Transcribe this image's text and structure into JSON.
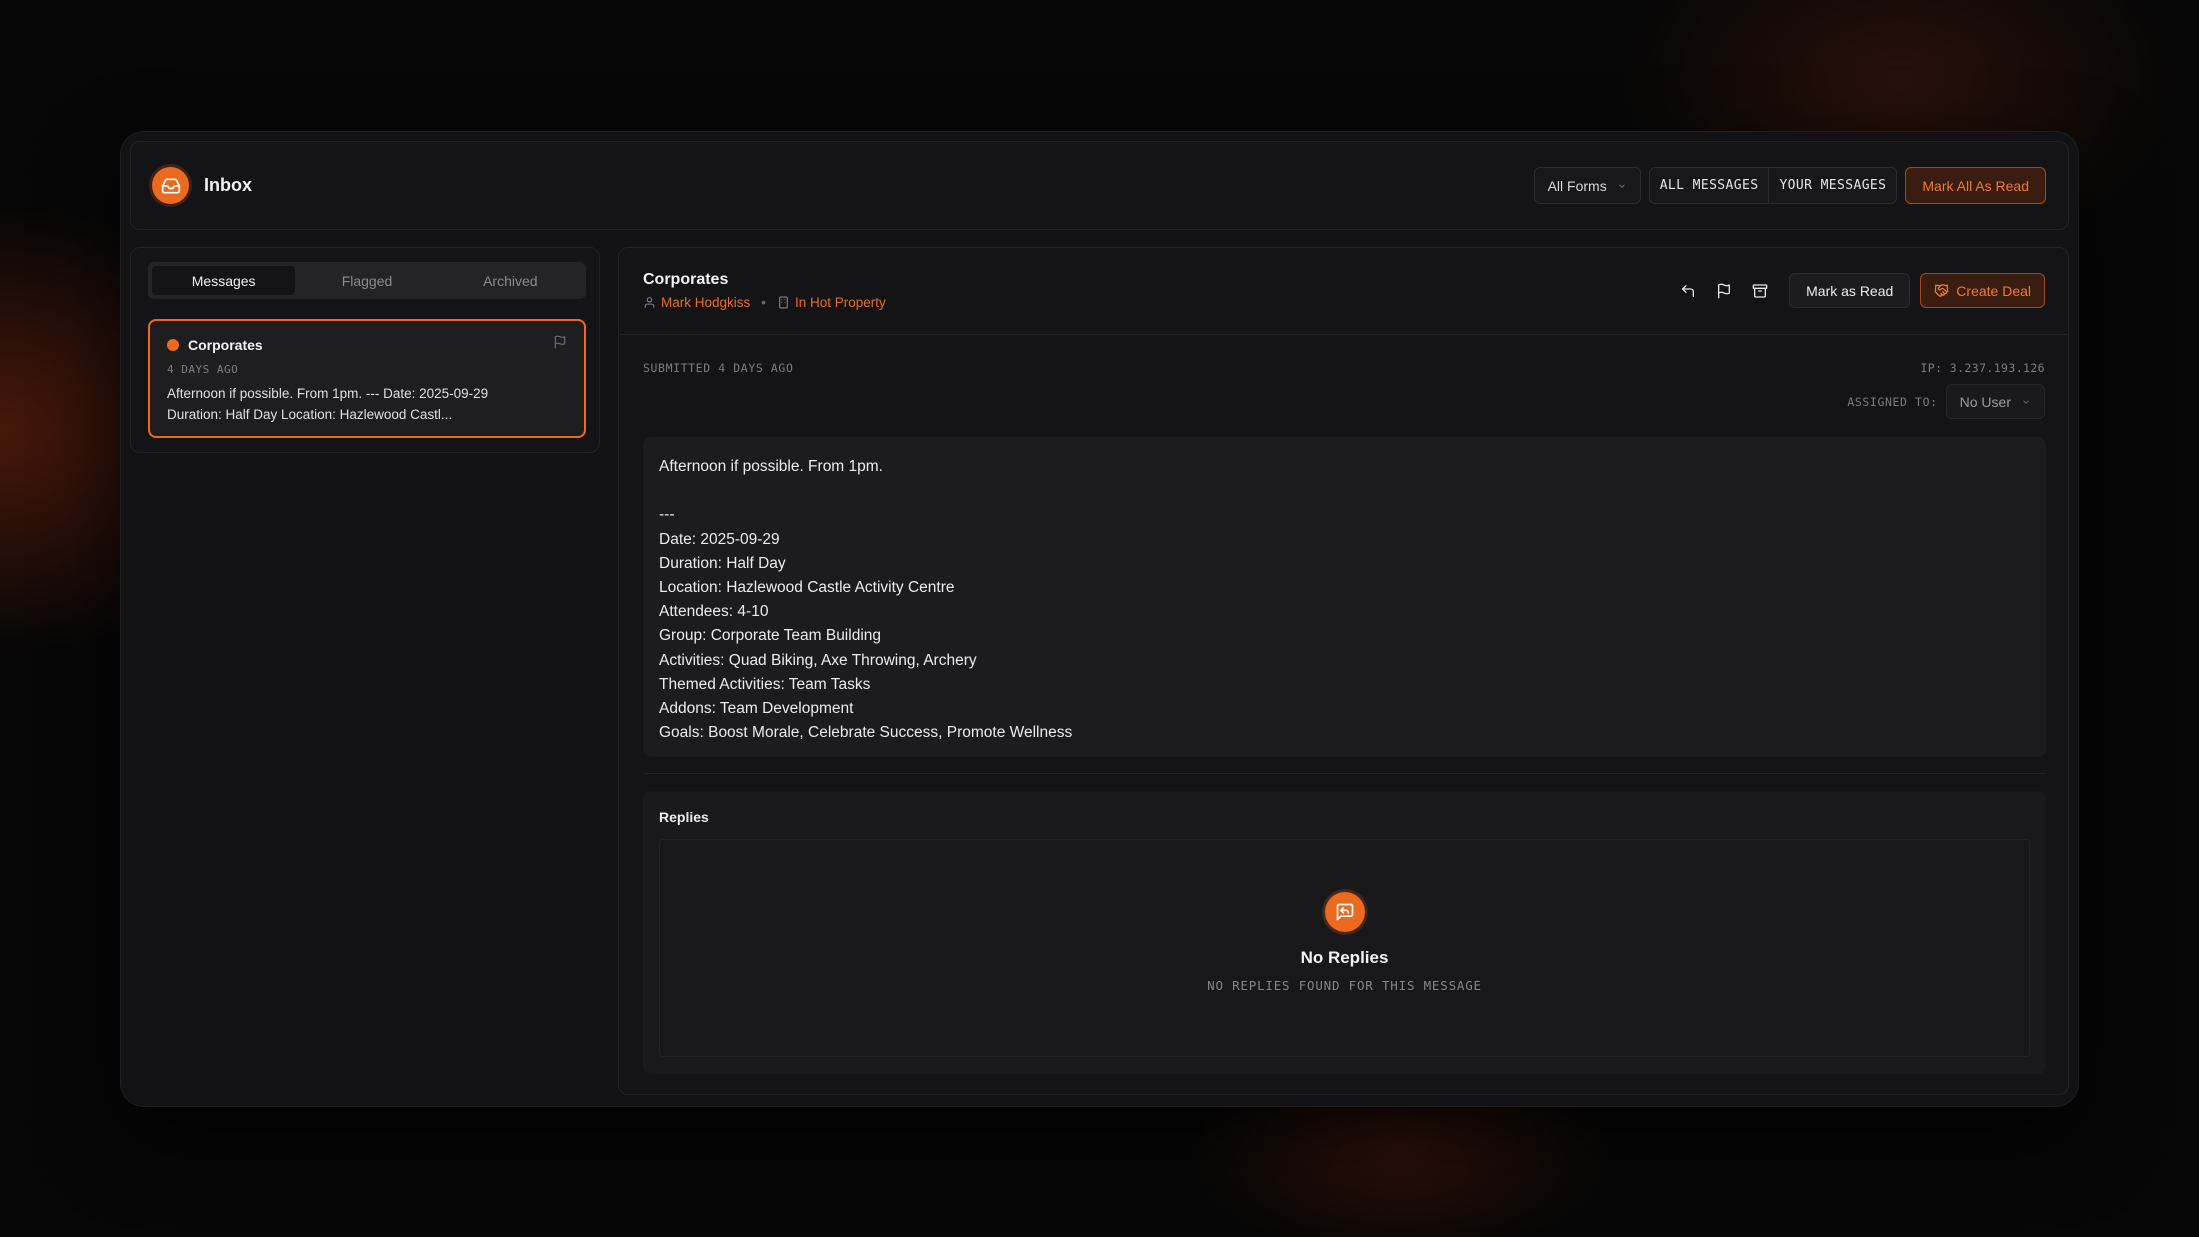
{
  "colors": {
    "accent": "#ec6a1f",
    "background": "#060606",
    "panel": "#141416"
  },
  "header": {
    "title": "Inbox",
    "logo_icon": "inbox-icon",
    "forms_filter": {
      "selected": "All Forms"
    },
    "view_toggle": [
      {
        "label": "ALL MESSAGES"
      },
      {
        "label": "YOUR MESSAGES"
      }
    ],
    "mark_all_read_label": "Mark All As Read"
  },
  "sidebar": {
    "tabs": [
      {
        "label": "Messages",
        "active": true
      },
      {
        "label": "Flagged",
        "active": false
      },
      {
        "label": "Archived",
        "active": false
      }
    ],
    "messages": [
      {
        "title": "Corporates",
        "time": "4 DAYS AGO",
        "preview_line1": "Afternoon if possible. From 1pm. --- Date: 2025-09-29",
        "preview_line2": "Duration: Half Day Location: Hazlewood Castl...",
        "unread": true
      }
    ]
  },
  "detail": {
    "title": "Corporates",
    "sender": "Mark Hodgkiss",
    "company": "In Hot Property",
    "actions": {
      "reply_icon": "reply-icon",
      "flag_icon": "flag-icon",
      "archive_icon": "archive-icon",
      "mark_read_label": "Mark as Read",
      "create_deal_label": "Create Deal"
    },
    "submitted": "SUBMITTED 4 DAYS AGO",
    "ip": "IP: 3.237.193.126",
    "assigned_label": "ASSIGNED TO:",
    "assigned_value": "No User",
    "body": "Afternoon if possible. From 1pm.\n\n---\nDate: 2025-09-29\nDuration: Half Day\nLocation: Hazlewood Castle Activity Centre\nAttendees: 4-10\nGroup: Corporate Team Building\nActivities: Quad Biking, Axe Throwing, Archery\nThemed Activities: Team Tasks\nAddons: Team Development\nGoals: Boost Morale, Celebrate Success, Promote Wellness",
    "replies": {
      "title": "Replies",
      "empty_title": "No Replies",
      "empty_subtitle": "NO REPLIES FOUND FOR THIS MESSAGE"
    }
  }
}
